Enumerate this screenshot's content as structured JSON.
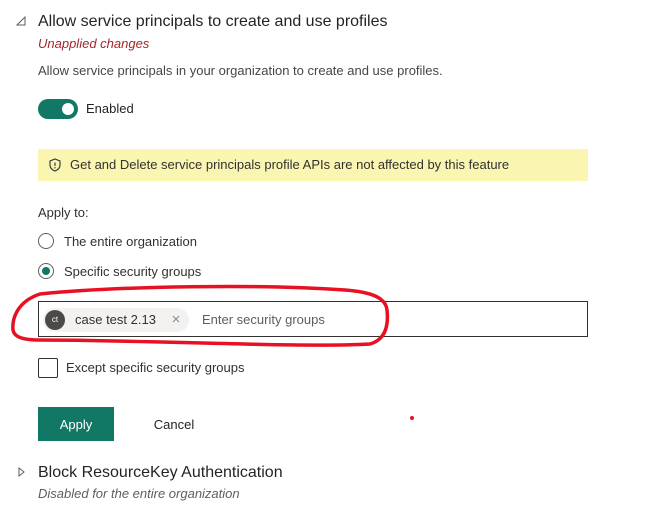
{
  "section": {
    "title": "Allow service principals to create and use profiles",
    "status": "Unapplied changes",
    "description": "Allow service principals in your organization to create and use profiles.",
    "toggle": {
      "state": "on",
      "label": "Enabled"
    },
    "banner": {
      "text": "Get and Delete service principals profile APIs are not affected by this feature",
      "icon": "shield-icon"
    }
  },
  "apply_to": {
    "label": "Apply to:",
    "options": [
      {
        "label": "The entire organization",
        "selected": false
      },
      {
        "label": "Specific security groups",
        "selected": true
      }
    ]
  },
  "picker": {
    "chips": [
      {
        "initials": "ct",
        "label": "case test 2.13"
      }
    ],
    "placeholder": "Enter security groups"
  },
  "except": {
    "label": "Except specific security groups",
    "checked": false
  },
  "buttons": {
    "apply": "Apply",
    "cancel": "Cancel"
  },
  "next_section": {
    "title": "Block ResourceKey Authentication",
    "status": "Disabled for the entire organization"
  },
  "colors": {
    "accent": "#117865",
    "warning_bg": "#fbf5b2",
    "unapplied": "#a4262c",
    "annotation": "#e81123"
  }
}
